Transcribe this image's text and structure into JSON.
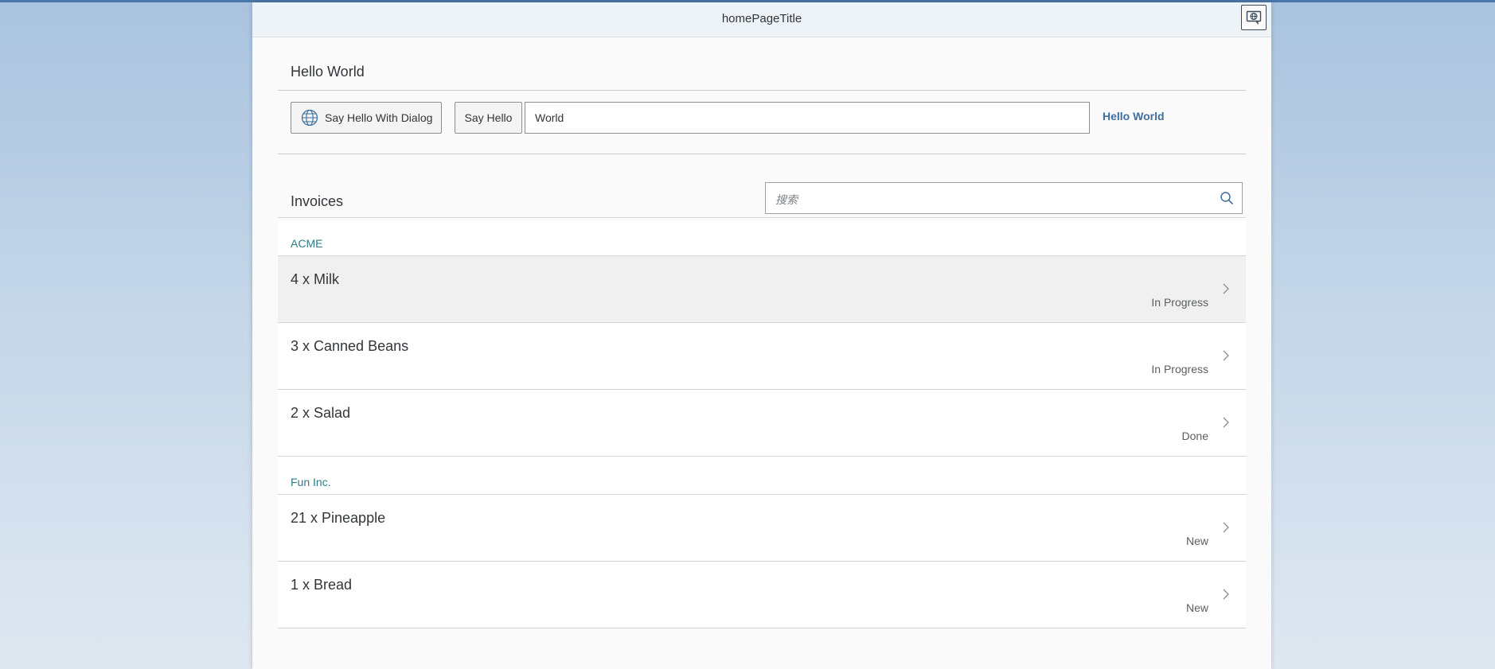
{
  "header": {
    "title": "homePageTitle",
    "action_icon": "feedback-icon"
  },
  "panel": {
    "title": "Hello World",
    "dialog_button": {
      "label": "Say Hello With Dialog",
      "icon": "globe-icon"
    },
    "hello_button": {
      "label": "Say Hello"
    },
    "name_input": {
      "value": "World"
    },
    "greeting_text": "Hello World"
  },
  "invoices": {
    "title": "Invoices",
    "search": {
      "placeholder": "搜索",
      "icon": "search-icon"
    },
    "groups": [
      {
        "label": "ACME",
        "items": [
          {
            "title": "4 x Milk",
            "status": "In Progress"
          },
          {
            "title": "3 x Canned Beans",
            "status": "In Progress"
          },
          {
            "title": "2 x Salad",
            "status": "Done"
          }
        ]
      },
      {
        "label": "Fun Inc.",
        "items": [
          {
            "title": "21 x Pineapple",
            "status": "New"
          },
          {
            "title": "1 x Bread",
            "status": "New"
          }
        ]
      }
    ]
  },
  "colors": {
    "accent": "#3d6e9e",
    "group_label": "#2b7c88",
    "header_bg": "#eef3f7"
  }
}
